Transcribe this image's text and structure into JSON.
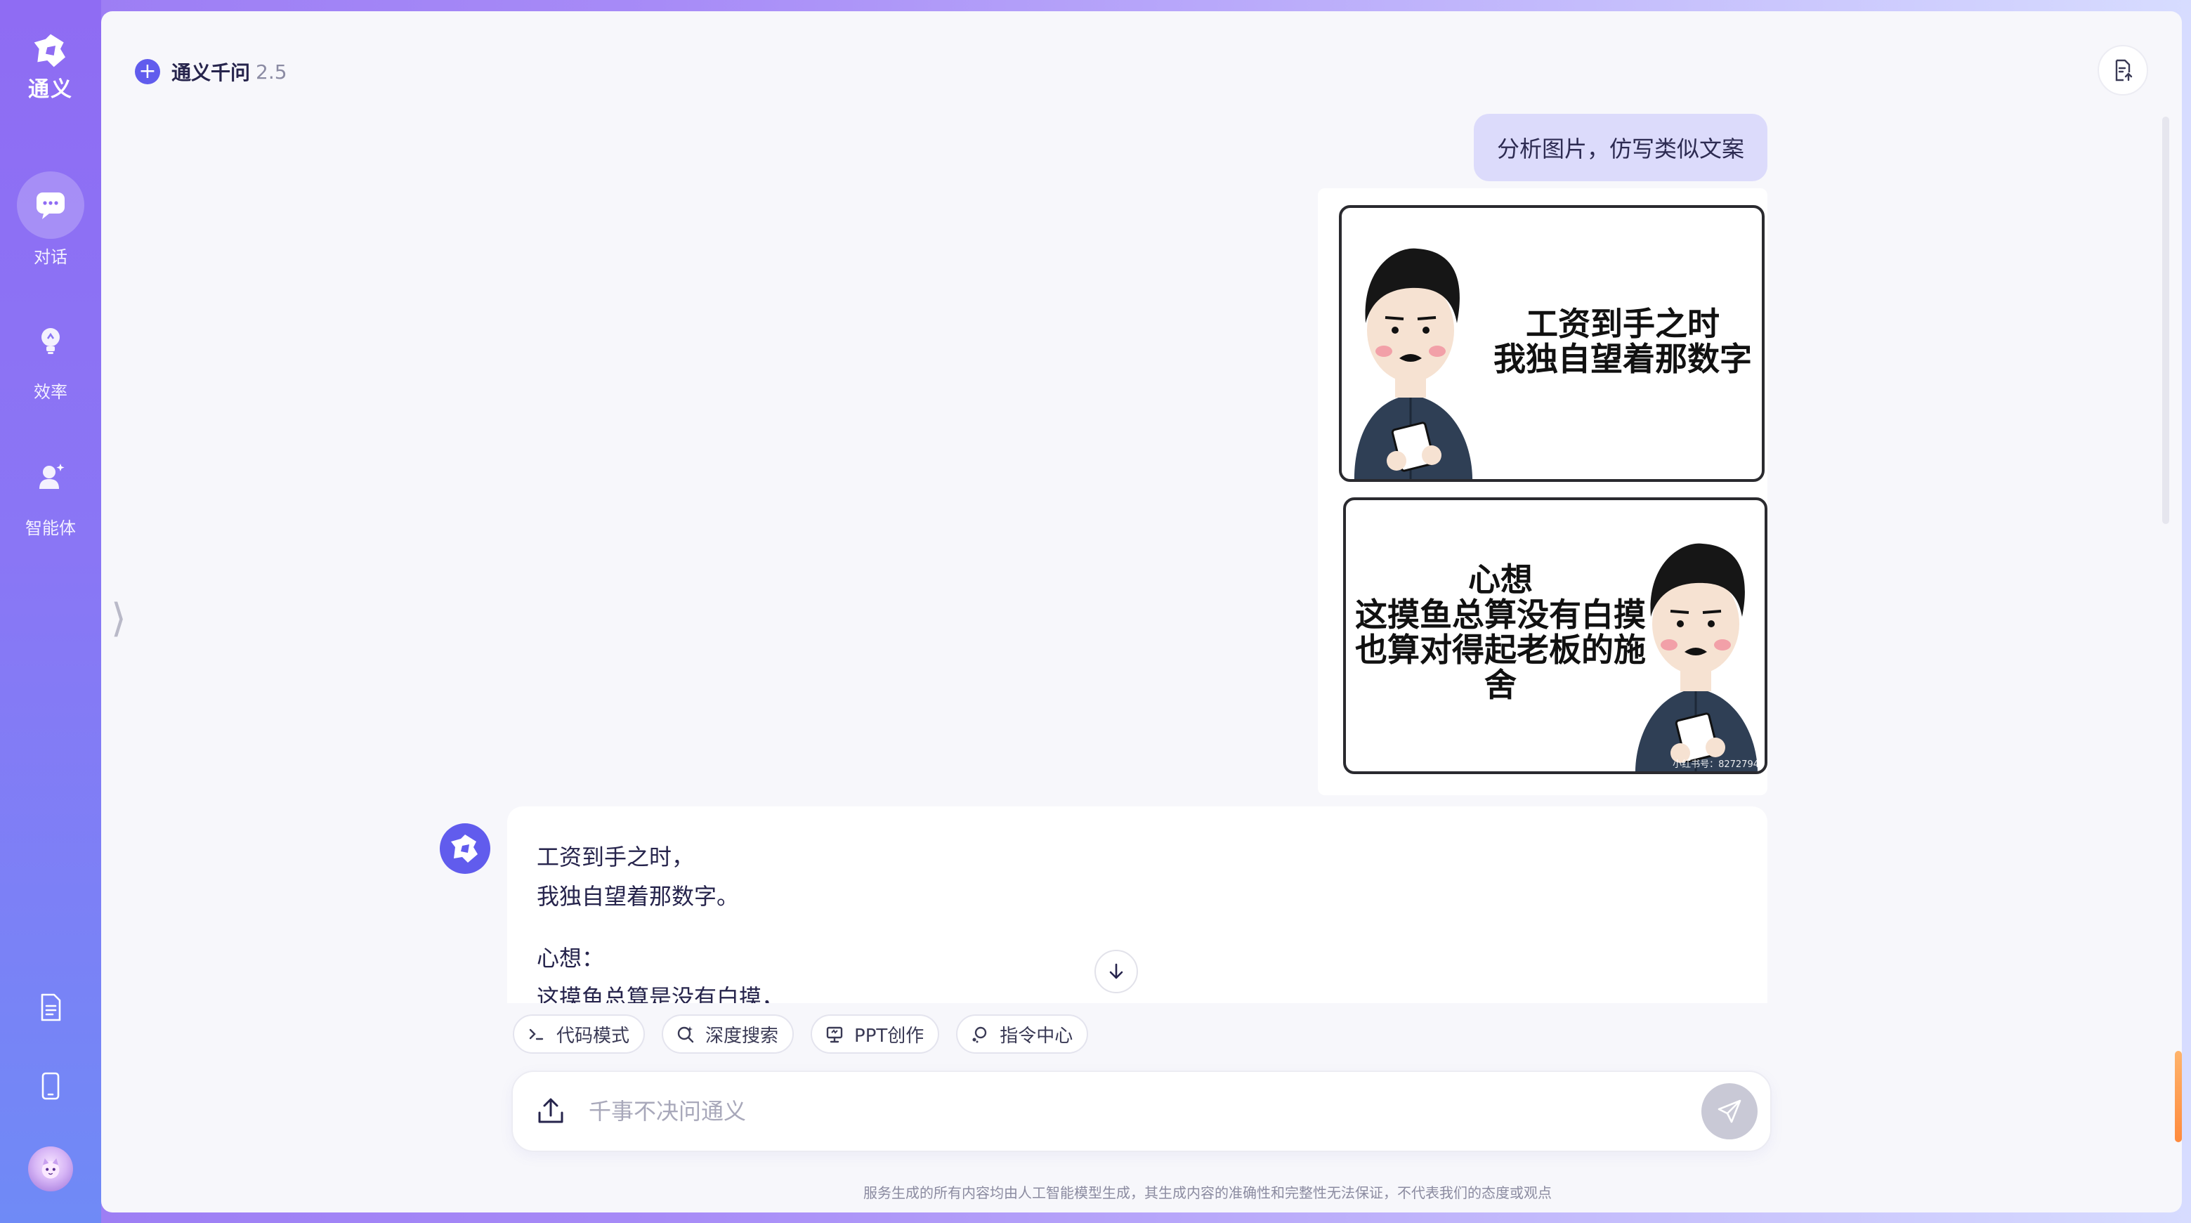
{
  "sidebar": {
    "brand": "通义",
    "nav": [
      {
        "label": "对话",
        "icon": "chat-bubble-icon",
        "active": true
      },
      {
        "label": "效率",
        "icon": "lightbulb-icon",
        "active": false
      },
      {
        "label": "智能体",
        "icon": "agent-person-icon",
        "active": false
      }
    ],
    "bottom_icons": [
      "document-icon",
      "tablet-icon"
    ],
    "user_avatar_icon": "user-avatar"
  },
  "header": {
    "model_name": "通义千问",
    "model_version": "2.5",
    "top_right_icon": "document-upload-icon"
  },
  "conversation": {
    "user_message": "分析图片，仿写类似文案",
    "user_image": {
      "panel1_line1": "工资到手之时",
      "panel1_line2": "我独自望着那数字",
      "panel2_line1": "心想",
      "panel2_line2": "这摸鱼总算没有白摸",
      "panel2_line3": "也算对得起老板的施舍",
      "watermark": "小红书号：8272794"
    },
    "assistant_reply": {
      "line1": "工资到手之时，",
      "line2": "我独自望着那数字。",
      "line3": "心想：",
      "line4": "这摸鱼总算是没有白摸，"
    }
  },
  "chips": [
    {
      "label": "代码模式",
      "icon": "terminal-icon"
    },
    {
      "label": "深度搜索",
      "icon": "deep-search-icon"
    },
    {
      "label": "PPT创作",
      "icon": "presentation-icon"
    },
    {
      "label": "指令中心",
      "icon": "command-center-icon"
    }
  ],
  "input": {
    "placeholder": "千事不决问通义",
    "value": ""
  },
  "disclaimer": "服务生成的所有内容均由人工智能模型生成，其生成内容的准确性和完整性无法保证，不代表我们的态度或观点",
  "colors": {
    "accent": "#615ced",
    "sidebar_top": "#8f6cf3",
    "sidebar_bottom": "#6f8af6",
    "user_bubble": "#dcdbfb"
  }
}
